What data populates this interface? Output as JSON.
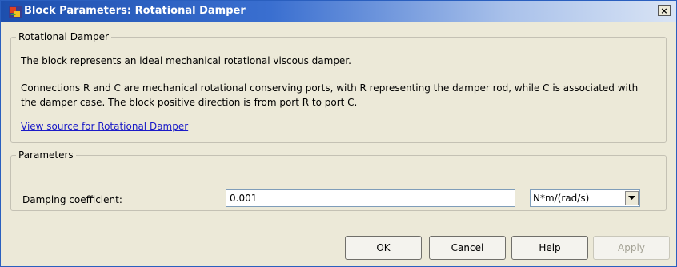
{
  "window": {
    "title": "Block Parameters: Rotational Damper",
    "app_icon": "simulink-block-icon",
    "close_label": "×"
  },
  "description_group": {
    "legend": "Rotational Damper",
    "line1": "The block represents an ideal mechanical rotational viscous damper.",
    "line2": "Connections R and C are mechanical rotational conserving ports, with R representing the damper rod, while C is associated with",
    "line3": "the damper case. The block positive direction is from port R to port C.",
    "link": "View source for Rotational Damper"
  },
  "parameters_group": {
    "legend": "Parameters",
    "damping_label": "Damping coefficient:",
    "damping_value": "0.001",
    "damping_units": "N*m/(rad/s)"
  },
  "buttons": {
    "ok": "OK",
    "cancel": "Cancel",
    "help": "Help",
    "apply": "Apply"
  }
}
